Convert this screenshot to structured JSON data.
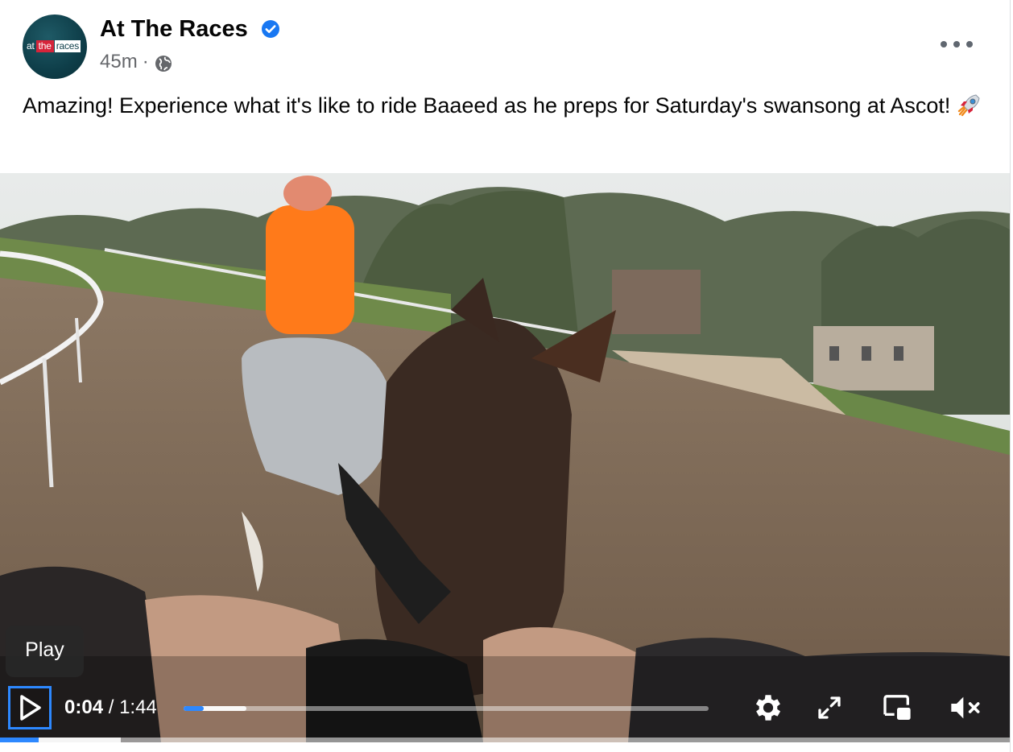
{
  "post": {
    "page_name": "At The Races",
    "avatar": {
      "logo_at": "at",
      "logo_the": "the",
      "logo_races": "races"
    },
    "verified_icon": "verified-badge-icon",
    "time_ago": "45m",
    "separator": "·",
    "privacy_icon": "globe-icon",
    "more_icon": "more-options-icon",
    "caption": "Amazing! Experience what it's like to ride Baaeed as he preps for Saturday's swansong at Ascot!",
    "caption_emoji": "rocket-emoji"
  },
  "video": {
    "tooltip": "Play",
    "play_icon": "play-icon",
    "current_time": "0:04",
    "time_separator": "/",
    "duration": "1:44",
    "progress_fraction": 0.038,
    "buffered_fraction": 0.12,
    "settings_icon": "gear-icon",
    "fullscreen_icon": "fullscreen-icon",
    "pip_icon": "picture-in-picture-icon",
    "mute_icon": "muted-speaker-icon",
    "accent_color": "#2d88ff"
  }
}
